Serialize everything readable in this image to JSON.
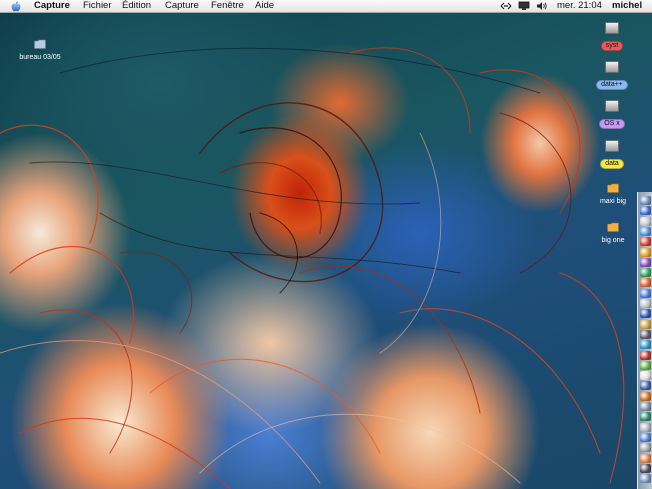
{
  "menubar": {
    "app_name": "Capture",
    "menus": [
      "Fichier",
      "Édition",
      "Capture",
      "Fenêtre",
      "Aide"
    ],
    "clock": "mer. 21:04",
    "user": "michel"
  },
  "desktop": {
    "left_icon": {
      "label": "bureau 03/05",
      "icon": "folder-icon"
    },
    "drives": [
      {
        "label": "syst",
        "color": "#e85a5a",
        "icon": "hard-drive-icon"
      },
      {
        "label": "data++",
        "color": "#8ab8f0",
        "icon": "hard-drive-icon"
      },
      {
        "label": "OS x",
        "color": "#c49af0",
        "icon": "hard-drive-icon"
      },
      {
        "label": "data",
        "color": "#f4e84a",
        "icon": "hard-drive-icon"
      }
    ],
    "folders": [
      {
        "label": "maxi big",
        "icon": "folder-icon"
      },
      {
        "label": "big one",
        "icon": "folder-icon"
      }
    ]
  },
  "dock": {
    "position": "right",
    "item_count": 28
  }
}
